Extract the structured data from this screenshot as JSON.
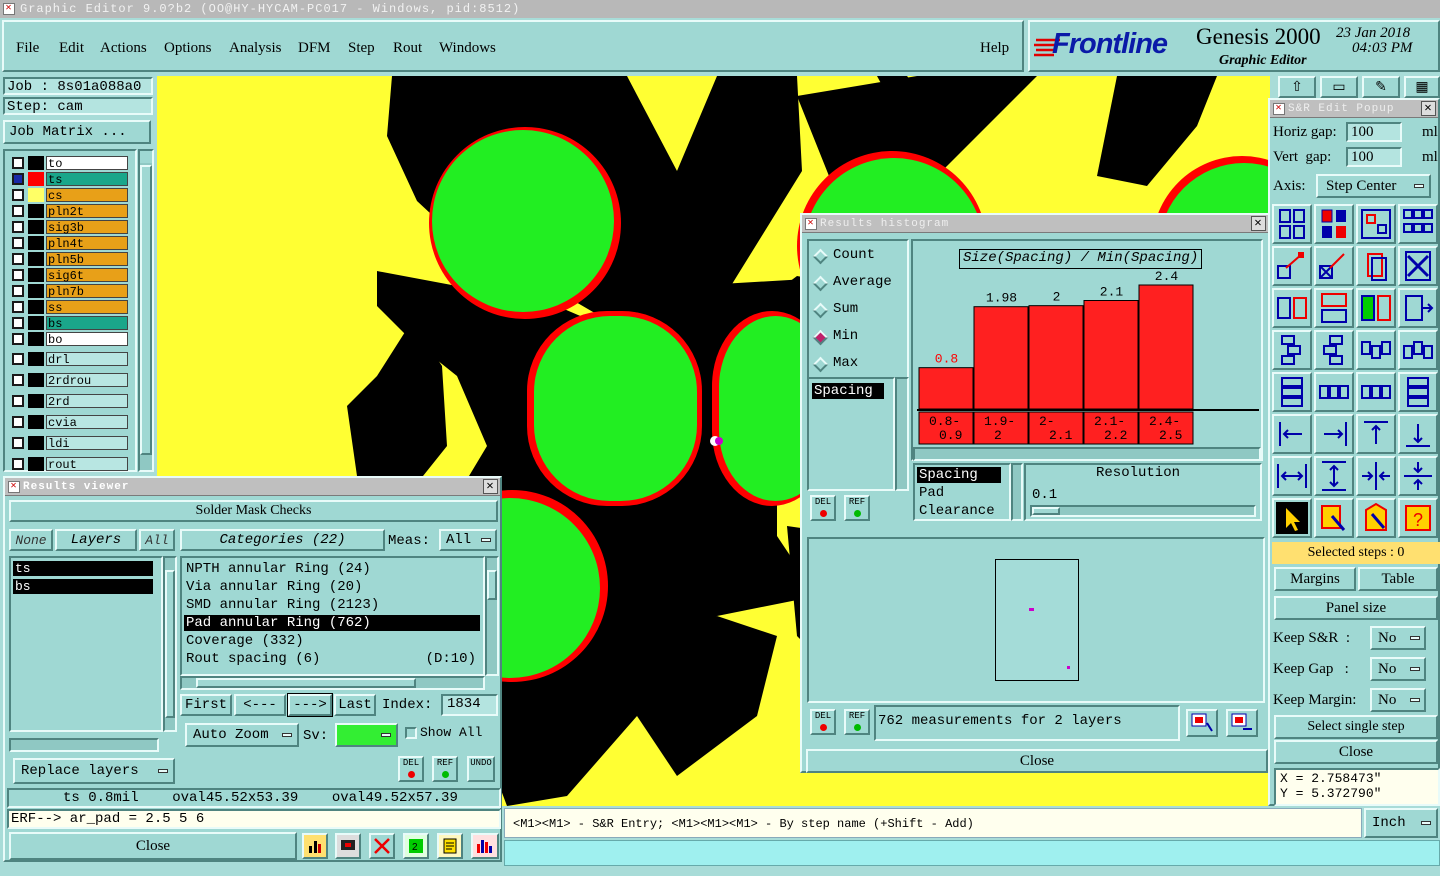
{
  "window": {
    "title": "Graphic Editor 9.0?b2 (OO@HY-HYCAM-PC017 - Windows, pid:8512)"
  },
  "menu": [
    "File",
    "Edit",
    "Actions",
    "Options",
    "Analysis",
    "DFM",
    "Step",
    "Rout",
    "Windows"
  ],
  "help_label": "Help",
  "brand": {
    "logo": "Frontline",
    "product": "Genesis 2000",
    "subtitle": "Graphic Editor",
    "date": "23 Jan 2018",
    "time": "04:03 PM"
  },
  "job": {
    "job_label": "Job : 8s01a088a0",
    "step_label": "Step: cam",
    "matrix_button": "Job Matrix ..."
  },
  "layers": [
    {
      "name": "to",
      "color": "#ffffff",
      "swatch": "#000000",
      "mark": "✶"
    },
    {
      "name": "ts",
      "color": "#1aa68a",
      "swatch": "#ff0000",
      "mark": "⊞",
      "selected": true
    },
    {
      "name": "cs",
      "color": "#e8a018",
      "swatch": "#ffff66",
      "mark": "⊞"
    },
    {
      "name": "pln2t",
      "color": "#e8a018",
      "swatch": "#000000",
      "mark": ""
    },
    {
      "name": "sig3b",
      "color": "#e8a018",
      "swatch": "#000000",
      "mark": "✶"
    },
    {
      "name": "pln4t",
      "color": "#e8a018",
      "swatch": "#000000",
      "mark": ""
    },
    {
      "name": "pln5b",
      "color": "#e8a018",
      "swatch": "#000000",
      "mark": ""
    },
    {
      "name": "sig6t",
      "color": "#e8a018",
      "swatch": "#000000",
      "mark": "✶"
    },
    {
      "name": "pln7b",
      "color": "#e8a018",
      "swatch": "#000000",
      "mark": ""
    },
    {
      "name": "ss",
      "color": "#e8a018",
      "swatch": "#000000",
      "mark": "✶"
    },
    {
      "name": "bs",
      "color": "#1aa68a",
      "swatch": "#000000",
      "mark": ""
    },
    {
      "name": "bo",
      "color": "#ffffff",
      "swatch": "#000000",
      "mark": ""
    }
  ],
  "layers_extra": [
    "drl",
    "2rdrou",
    "2rd",
    "cvia",
    "ldi",
    "rout"
  ],
  "results_viewer": {
    "title": "Results viewer",
    "header": "Solder Mask Checks",
    "none_btn": "None",
    "layers_btn": "Layers",
    "all_btn": "All",
    "categories_btn": "Categories (22)",
    "meas_label": "Meas:",
    "meas_value": "All",
    "layer_items": [
      "ts",
      "bs"
    ],
    "categories": [
      {
        "label": "NPTH annular Ring (24)",
        "extra": ""
      },
      {
        "label": "Via annular Ring (20)",
        "extra": ""
      },
      {
        "label": "SMD annular Ring (2123)",
        "extra": ""
      },
      {
        "label": "Pad annular Ring (762)",
        "extra": "",
        "selected": true
      },
      {
        "label": "Coverage (332)",
        "extra": ""
      },
      {
        "label": "Rout spacing (6)",
        "extra": "(D:10)"
      }
    ],
    "first_btn": "First",
    "prev_btn": "<---",
    "next_btn": "--->",
    "last_btn": "Last",
    "index_label": "Index:",
    "index_value": "1834",
    "auto_zoom": "Auto Zoom",
    "sv_label": "Sv:",
    "show_all": "Show All",
    "replace_layers": "Replace layers",
    "del": "DEL",
    "ref": "REF",
    "undo": "UNDO",
    "status": "ts 0.8mil    oval45.52x53.39    oval49.52x57.39",
    "erf": "ERF--> ar_pad = 2.5 5 6",
    "close": "Close"
  },
  "histogram": {
    "title": "Results histogram",
    "modes": [
      "Count",
      "Average",
      "Sum",
      "Min",
      "Max"
    ],
    "selected_mode": "Min",
    "list_top": [
      "Spacing"
    ],
    "list_bottom": [
      "Spacing",
      "Pad",
      "Clearance"
    ],
    "chart_title": "Size(Spacing) / Min(Spacing)",
    "resolution_label": "Resolution",
    "resolution_value": "0.1",
    "del": "DEL",
    "ref": "REF",
    "footer": "762 measurements for 2 layers",
    "close": "Close"
  },
  "chart_data": {
    "type": "bar",
    "title": "Size(Spacing) / Min(Spacing)",
    "categories": [
      "0.8-0.9",
      "1.9-2",
      "2-2.1",
      "2.1-2.2",
      "2.4-2.5"
    ],
    "category_lines": [
      [
        "0.8-",
        "0.9"
      ],
      [
        "1.9-",
        "2"
      ],
      [
        "2-",
        "2.1"
      ],
      [
        "2.1-",
        "2.2"
      ],
      [
        "2.4-",
        "2.5"
      ]
    ],
    "values": [
      0.8,
      1.98,
      2,
      2.1,
      2.4
    ],
    "value_labels": [
      "0.8",
      "1.98",
      "2",
      "2.1",
      "2.4"
    ],
    "ylim": [
      0,
      2.4
    ],
    "colors": {
      "bar": "#ff2020",
      "first_label": "#ff0000"
    }
  },
  "sr_popup": {
    "title": "S&R Edit Popup",
    "horiz_label": "Horiz gap:",
    "horiz_value": "100",
    "vert_label": "Vert  gap:",
    "vert_value": "100",
    "unit": "ml",
    "axis_label": "Axis:",
    "axis_value": "Step Center",
    "selected_steps": "Selected steps : 0",
    "margins": "Margins",
    "table": "Table",
    "panel_size": "Panel size",
    "keep_sr": "Keep S&R  :",
    "keep_gap": "Keep Gap   :",
    "keep_margin": "Keep Margin:",
    "no": "No",
    "select_single": "Select single step",
    "close": "Close"
  },
  "coords": {
    "x": "X = 2.758473\"",
    "y": "Y = 5.372790\""
  },
  "status_line": "<M1><M1> - S&R Entry; <M1><M1><M1> - By step name (+Shift - Add)",
  "units": "Inch"
}
